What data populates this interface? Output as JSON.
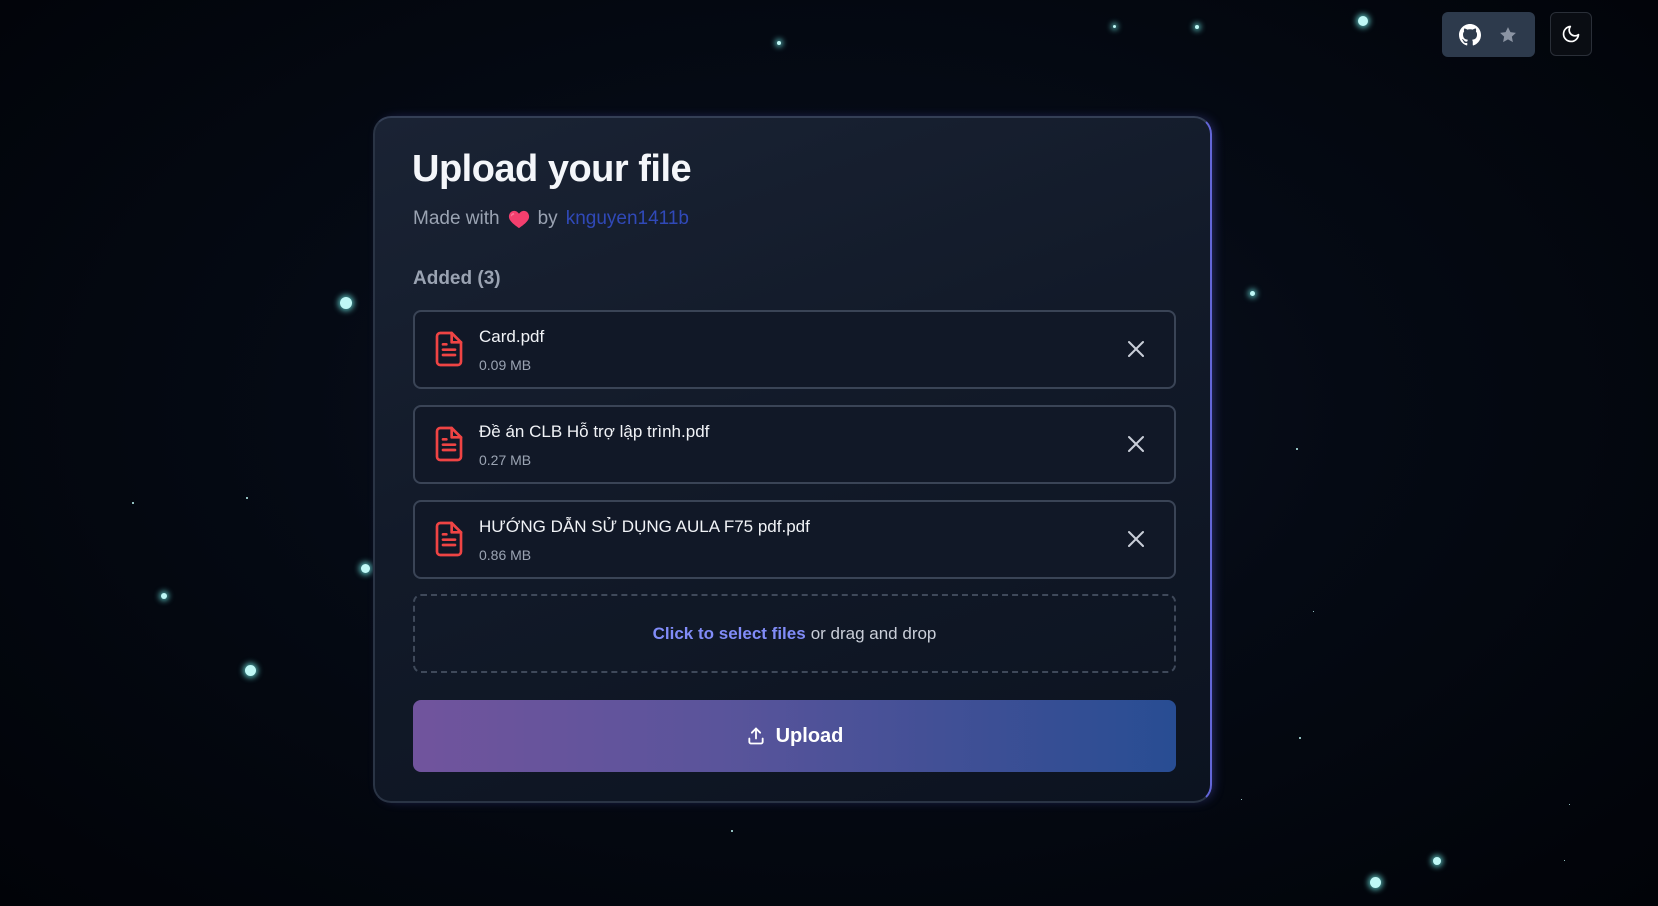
{
  "header": {
    "github_icon": "github-icon",
    "star_icon": "star-icon",
    "theme_icon": "moon-icon"
  },
  "card": {
    "title": "Upload your file",
    "made_with": "Made with",
    "by": "by",
    "author": "knguyen1411b",
    "heart_icon": "heart-icon",
    "added_label": "Added (3)"
  },
  "files": [
    {
      "name": "Card.pdf",
      "size": "0.09 MB",
      "icon": "file-text-icon"
    },
    {
      "name": "Đề án CLB Hỗ trợ lập trình.pdf",
      "size": "0.27 MB",
      "icon": "file-text-icon"
    },
    {
      "name": "HƯỚNG DẪN SỬ DỤNG AULA F75 pdf.pdf",
      "size": "0.86 MB",
      "icon": "file-text-icon"
    }
  ],
  "dropzone": {
    "link_text": "Click to select files",
    "rest_text": "or drag and drop"
  },
  "upload": {
    "label": "Upload",
    "icon": "upload-icon"
  },
  "colors": {
    "background": "#02050c",
    "card": "#141c2b",
    "accent": "#818cf8",
    "author_link": "#3049b8",
    "file_icon": "#ef4444",
    "upload_gradient_start": "#71549d",
    "upload_gradient_end": "#284d93"
  }
}
